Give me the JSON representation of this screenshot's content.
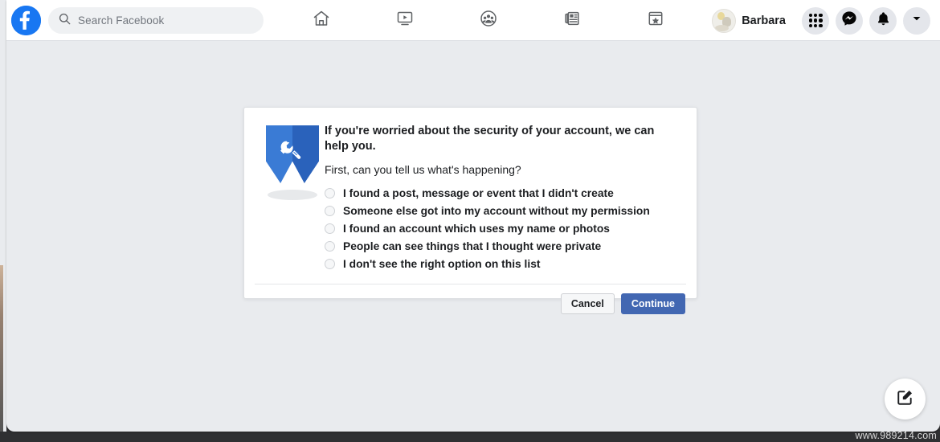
{
  "topbar": {
    "logo_icon": "facebook-logo-icon",
    "search": {
      "icon": "search-icon",
      "placeholder": "Search Facebook",
      "value": "Search Facebook"
    },
    "nav_items": [
      {
        "name": "home",
        "icon": "home-icon"
      },
      {
        "name": "watch",
        "icon": "video-screen-icon"
      },
      {
        "name": "groups",
        "icon": "groups-icon"
      },
      {
        "name": "news",
        "icon": "newspaper-icon"
      },
      {
        "name": "gaming",
        "icon": "star-window-icon"
      }
    ],
    "profile": {
      "name": "Barbara",
      "avatar_icon": "user-avatar"
    },
    "actions": [
      {
        "name": "menu",
        "icon": "grid-dots-icon"
      },
      {
        "name": "messenger",
        "icon": "messenger-icon"
      },
      {
        "name": "notifications",
        "icon": "bell-icon"
      },
      {
        "name": "account",
        "icon": "chevron-down-icon"
      }
    ]
  },
  "dialog": {
    "illustration_icon": "shield-wrench-icon",
    "title": "If you're worried about the security of your account, we can help you.",
    "subtitle": "First, can you tell us what's happening?",
    "options": [
      {
        "label": "I found a post, message or event that I didn't create",
        "selected": false
      },
      {
        "label": "Someone else got into my account without my permission",
        "selected": false
      },
      {
        "label": "I found an account which uses my name or photos",
        "selected": false
      },
      {
        "label": "People can see things that I thought were private",
        "selected": false
      },
      {
        "label": "I don't see the right option on this list",
        "selected": false
      }
    ],
    "cancel_label": "Cancel",
    "continue_label": "Continue"
  },
  "fab": {
    "icon": "compose-edit-icon"
  },
  "watermark": {
    "text": "www.989214.com"
  },
  "colors": {
    "facebook_blue": "#1877f2",
    "continue_button": "#4267b2",
    "page_background": "#e9ebee",
    "shield_light": "#3a7bd5",
    "shield_dark": "#2a62bb"
  }
}
